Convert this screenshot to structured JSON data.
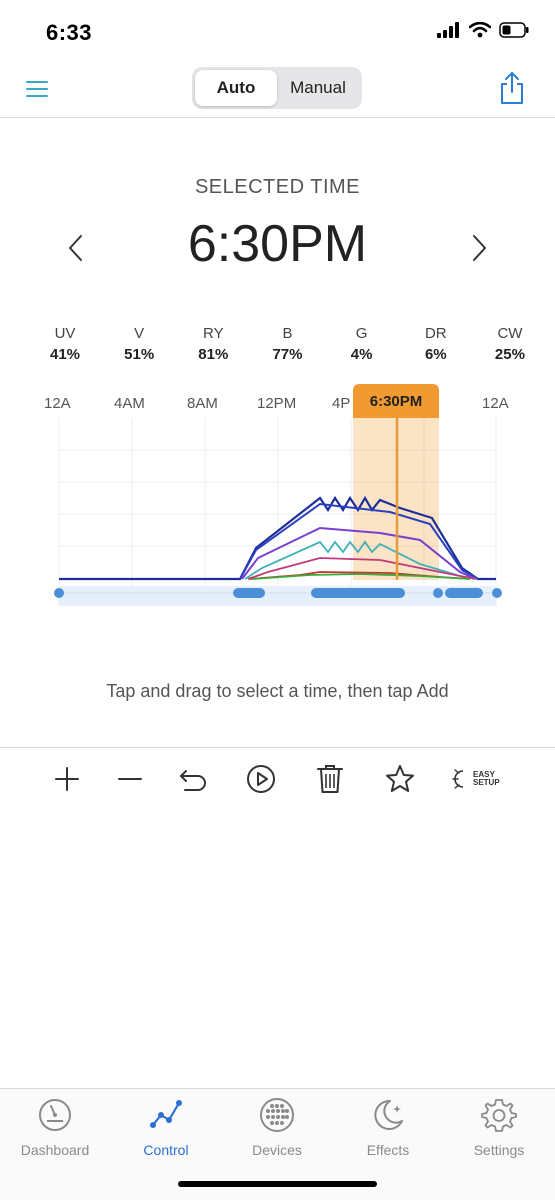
{
  "status": {
    "time": "6:33"
  },
  "header": {
    "mode_options": [
      "Auto",
      "Manual"
    ],
    "active_mode": "Auto"
  },
  "selected": {
    "label": "SELECTED TIME",
    "time": "6:30PM"
  },
  "channels": [
    {
      "name": "UV",
      "value": "41%"
    },
    {
      "name": "V",
      "value": "51%"
    },
    {
      "name": "RY",
      "value": "81%"
    },
    {
      "name": "B",
      "value": "77%"
    },
    {
      "name": "G",
      "value": "4%"
    },
    {
      "name": "DR",
      "value": "6%"
    },
    {
      "name": "CW",
      "value": "25%"
    }
  ],
  "timeline": {
    "labels": [
      "12A",
      "4AM",
      "8AM",
      "12PM",
      "4P",
      "12A"
    ],
    "marker": "6:30PM"
  },
  "chart_colors": {
    "uv": "#2a3fbf",
    "v": "#7a3fd0",
    "ry": "#c23a7a",
    "b": "#40b0b8",
    "g": "#3caa3c",
    "dr": "#c0392b",
    "cw": "#1f2f9a",
    "marker": "#f29a32",
    "dots": "#4a8fd8"
  },
  "hint": "Tap and drag to select a time, then tap Add",
  "toolbar": {
    "easy_setup_line1": "EASY",
    "easy_setup_line2": "SETUP"
  },
  "nav": {
    "items": [
      {
        "label": "Dashboard",
        "icon": "gauge-icon"
      },
      {
        "label": "Control",
        "icon": "graph-icon"
      },
      {
        "label": "Devices",
        "icon": "led-grid-icon"
      },
      {
        "label": "Effects",
        "icon": "moon-stars-icon"
      },
      {
        "label": "Settings",
        "icon": "gear-icon"
      }
    ],
    "active": "Control"
  }
}
